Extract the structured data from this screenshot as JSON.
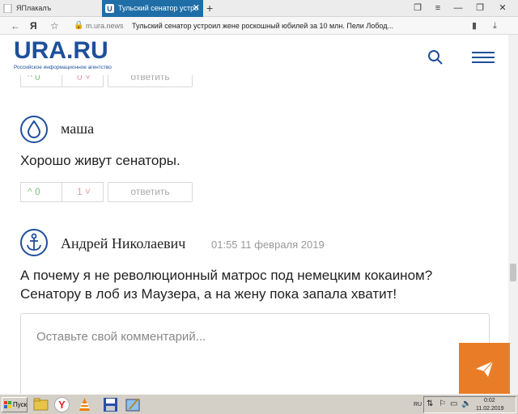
{
  "browser": {
    "tabs": [
      {
        "label": "ЯПлакалъ"
      },
      {
        "label": "Тульский сенатор устро"
      }
    ],
    "address": {
      "domain": "m.ura.news",
      "page_title": "Тульский сенатор устроил жене роскошный юбилей за 10 млн. Пели Лобод..."
    }
  },
  "site": {
    "logo": "URA.RU",
    "tagline": "Российское информационное агентство"
  },
  "top_votes": {
    "up": "0",
    "down": "0",
    "reply": "ответить"
  },
  "comments": [
    {
      "author": "маша",
      "date": "",
      "text": "Хорошо живут сенаторы.",
      "votes": {
        "up": "0",
        "down": "1",
        "reply": "ответить"
      },
      "avatar_icon": "drop-icon"
    },
    {
      "author": "Андрей Николаевич",
      "date": "01:55 11 февраля 2019",
      "text": "А почему я не революционный матрос под немецким кокаином? Сенатору в лоб из Маузера, а на жену пока запала хватит!",
      "avatar_icon": "anchor-icon"
    }
  ],
  "comment_form": {
    "placeholder": "Оставьте свой комментарий..."
  },
  "taskbar": {
    "start": "Пуск",
    "lang": "RU",
    "time": "0:02",
    "date": "11.02.2019"
  },
  "colors": {
    "brand": "#1e4f9c",
    "send_button": "#e97d27",
    "up_vote": "#7fc47f",
    "down_vote": "#e89aa0"
  }
}
